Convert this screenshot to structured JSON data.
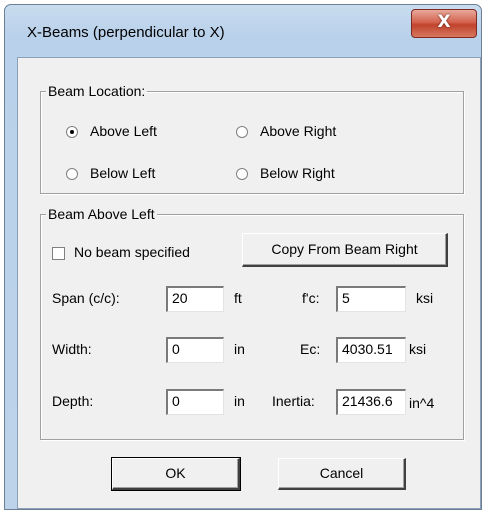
{
  "window": {
    "title": "X-Beams (perpendicular to X)",
    "close_glyph": "X"
  },
  "beam_location": {
    "legend": "Beam Location:",
    "options": [
      "Above Left",
      "Above Right",
      "Below Left",
      "Below Right"
    ],
    "selected": "Above Left"
  },
  "beam_group": {
    "legend": "Beam Above Left",
    "no_beam_label": "No beam specified",
    "no_beam_checked": false,
    "copy_button": "Copy From Beam Right",
    "span_label": "Span (c/c):",
    "span_value": "20",
    "span_unit": "ft",
    "width_label": "Width:",
    "width_value": "0",
    "width_unit": "in",
    "depth_label": "Depth:",
    "depth_value": "0",
    "depth_unit": "in",
    "fc_label": "f'c:",
    "fc_value": "5",
    "fc_unit": "ksi",
    "ec_label": "Ec:",
    "ec_value": "4030.51",
    "ec_unit": "ksi",
    "inertia_label": "Inertia:",
    "inertia_value": "21436.6",
    "inertia_unit": "in^4"
  },
  "footer": {
    "ok": "OK",
    "cancel": "Cancel"
  }
}
